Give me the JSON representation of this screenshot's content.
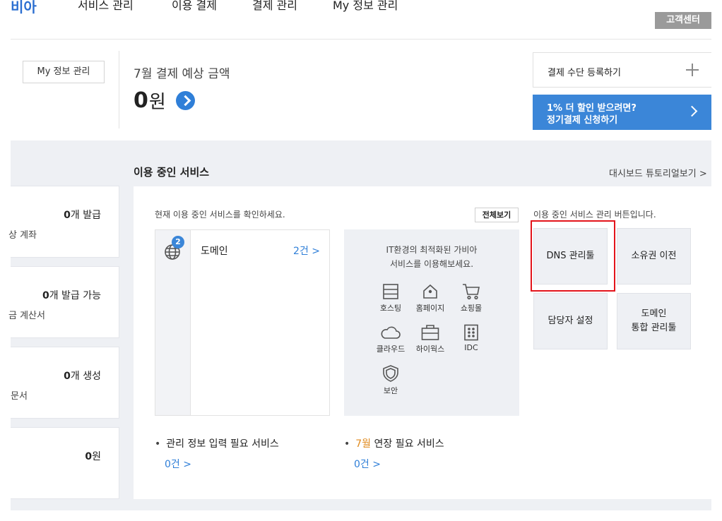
{
  "nav": {
    "logo": "비아",
    "items": [
      "서비스 관리",
      "이용 결제",
      "결제 관리",
      "My 정보 관리"
    ],
    "customer_center": "고객센터"
  },
  "header": {
    "my_info_button": "My 정보 관리",
    "expected_payment_label": "7월 결제 예상 금액",
    "expected_amount": "0",
    "amount_unit": "원",
    "register_payment": "결제 수단 등록하기",
    "promo_line1": "1% 더 할인 받으려면?",
    "promo_line2": "정기결제 신청하기"
  },
  "left_cards": [
    {
      "value": "0",
      "value_suffix": "개 발급",
      "sub": "상 계좌"
    },
    {
      "value": "0",
      "value_suffix": "개 발급 가능",
      "sub": "금 계산서"
    },
    {
      "value": "0",
      "value_suffix": "개 생성",
      "sub": "문서"
    },
    {
      "value": "0",
      "value_suffix": "원",
      "sub": ""
    }
  ],
  "services": {
    "title": "이용 중인 서비스",
    "tutorial_link": "대시보드 튜토리얼보기 >",
    "current_text": "현재 이용 중인 서비스를 확인하세요.",
    "view_all": "전체보기",
    "domain_badge": "2",
    "domain_label": "도메인",
    "domain_count": "2건 >",
    "promo_line1": "IT환경의 최적화된 가비아",
    "promo_line2": "서비스를 이용해보세요.",
    "icons": [
      {
        "label": "호스팅",
        "icon": "server-icon"
      },
      {
        "label": "홈페이지",
        "icon": "home-icon"
      },
      {
        "label": "쇼핑몰",
        "icon": "cart-icon"
      },
      {
        "label": "클라우드",
        "icon": "cloud-icon"
      },
      {
        "label": "하이웍스",
        "icon": "briefcase-icon"
      },
      {
        "label": "IDC",
        "icon": "building-icon"
      },
      {
        "label": "보안",
        "icon": "shield-icon"
      }
    ],
    "manage_text": "이용 중인 서비스 관리 버튼입니다.",
    "manage_buttons": [
      "DNS 관리툴",
      "소유권 이전",
      "담당자 설정",
      "도메인",
      "통합 관리툴"
    ],
    "needs_info_label": "관리 정보 입력 필요 서비스",
    "needs_info_count": "0건 >",
    "renewal_month": "7월",
    "renewal_label": " 연장 필요 서비스",
    "renewal_count": "0건 >"
  }
}
